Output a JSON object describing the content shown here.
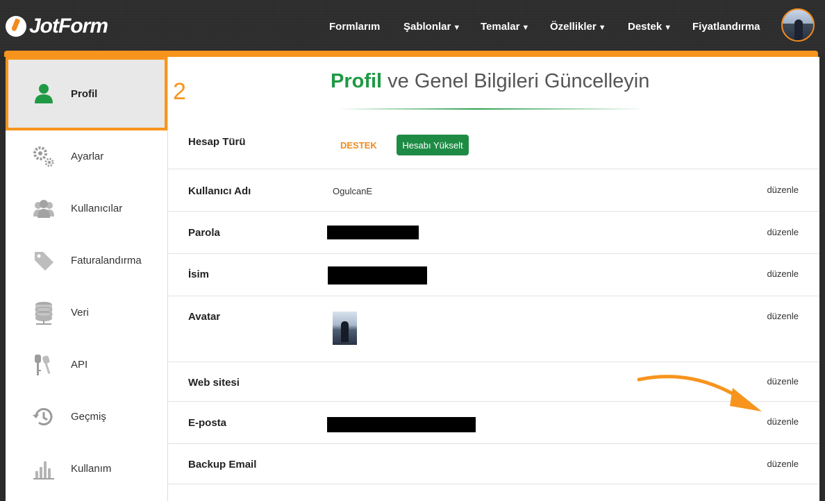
{
  "brand": {
    "name": "JotForm"
  },
  "nav": [
    {
      "label": "Formlarım",
      "dropdown": false
    },
    {
      "label": "Şablonlar",
      "dropdown": true
    },
    {
      "label": "Temalar",
      "dropdown": true
    },
    {
      "label": "Özellikler",
      "dropdown": true
    },
    {
      "label": "Destek",
      "dropdown": true
    },
    {
      "label": "Fiyatlandırma",
      "dropdown": false
    }
  ],
  "sidebar": {
    "items": [
      {
        "label": "Profil",
        "icon": "user-icon",
        "active": true
      },
      {
        "label": "Ayarlar",
        "icon": "gears-icon",
        "active": false
      },
      {
        "label": "Kullanıcılar",
        "icon": "users-icon",
        "active": false
      },
      {
        "label": "Faturalandırma",
        "icon": "tag-icon",
        "active": false
      },
      {
        "label": "Veri",
        "icon": "database-icon",
        "active": false
      },
      {
        "label": "API",
        "icon": "keys-icon",
        "active": false
      },
      {
        "label": "Geçmiş",
        "icon": "history-icon",
        "active": false
      },
      {
        "label": "Kullanım",
        "icon": "bar-chart-icon",
        "active": false
      }
    ]
  },
  "annotation": {
    "step_number": "2"
  },
  "main": {
    "heading_strong": "Profil",
    "heading_rest": " ve Genel Bilgileri Güncelleyin",
    "account_type": {
      "label": "Hesap Türü",
      "badge": "DESTEK",
      "upgrade_button": "Hesabı Yükselt"
    },
    "username": {
      "label": "Kullanıcı Adı",
      "value": "OgulcanE",
      "edit": "düzenle"
    },
    "password": {
      "label": "Parola",
      "edit": "düzenle"
    },
    "name": {
      "label": "İsim",
      "edit": "düzenle"
    },
    "avatar": {
      "label": "Avatar",
      "edit": "düzenle"
    },
    "website": {
      "label": "Web sitesi",
      "edit": "düzenle"
    },
    "email": {
      "label": "E-posta",
      "edit": "düzenle"
    },
    "backup_email": {
      "label": "Backup Email",
      "edit": "düzenle"
    }
  },
  "colors": {
    "accent": "#f7941d",
    "brand_green": "#1f9a44",
    "button_green": "#1e8b45",
    "topbar": "#2d2d2d"
  }
}
